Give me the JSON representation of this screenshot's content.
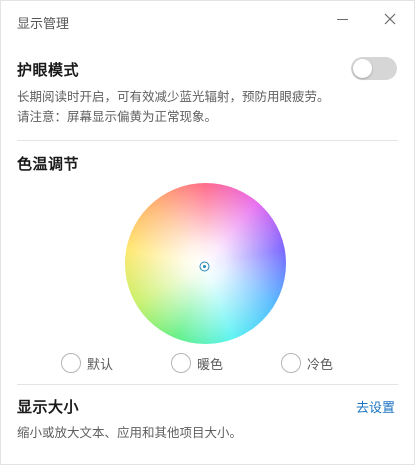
{
  "window": {
    "title": "显示管理"
  },
  "eye_protection": {
    "title": "护眼模式",
    "description_line1": "长期阅读时开启，可有效减少蓝光辐射，预防用眼疲劳。",
    "description_line2": "请注意：屏幕显示偏黄为正常现象。",
    "enabled": false
  },
  "color_temperature": {
    "title": "色温调节",
    "options": [
      {
        "label": "默认",
        "selected": false
      },
      {
        "label": "暖色",
        "selected": false
      },
      {
        "label": "冷色",
        "selected": false
      }
    ]
  },
  "display_size": {
    "title": "显示大小",
    "link_label": "去设置",
    "description": "缩小或放大文本、应用和其他项目大小。"
  },
  "colors": {
    "link": "#1a73c4",
    "toggle_off": "#d6d6d6",
    "marker": "#2a86b5"
  }
}
